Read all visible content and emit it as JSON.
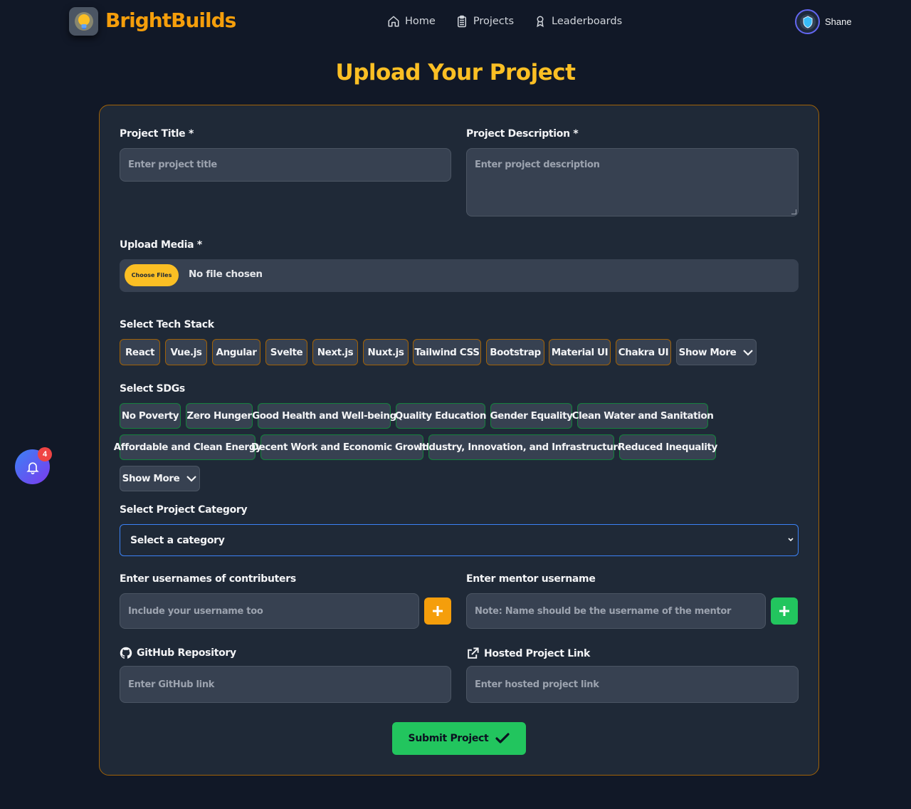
{
  "nav": {
    "brand": "BrightBuilds",
    "links": [
      {
        "label": "Home",
        "icon": "home-icon"
      },
      {
        "label": "Projects",
        "icon": "clipboard-icon"
      },
      {
        "label": "Leaderboards",
        "icon": "award-icon"
      }
    ],
    "user_name": "Shane"
  },
  "page_title": "Upload Your Project",
  "form": {
    "title_label": "Project Title *",
    "title_placeholder": "Enter project title",
    "description_label": "Project Description *",
    "description_placeholder": "Enter project description",
    "media_label": "Upload Media *",
    "choose_files": "Choose Files",
    "no_file": "No file chosen",
    "tech_label": "Select Tech Stack",
    "tech_stack": [
      "React",
      "Vue.js",
      "Angular",
      "Svelte",
      "Next.js",
      "Nuxt.js",
      "Tailwind CSS",
      "Bootstrap",
      "Material UI",
      "Chakra UI"
    ],
    "tech_show_more": "Show More",
    "sdg_label": "Select SDGs",
    "sdgs": [
      "No Poverty",
      "Zero Hunger",
      "Good Health and Well-being",
      "Quality Education",
      "Gender Equality",
      "Clean Water and Sanitation",
      "Affordable and Clean Energy",
      "Decent Work and Economic Growth",
      "Industry, Innovation, and Infrastructure",
      "Reduced Inequality"
    ],
    "sdg_show_more": "Show More",
    "category_label": "Select Project Category",
    "category_selected": "Select a category",
    "contributors_label": "Enter usernames of contributers",
    "contributors_placeholder": "Include your username too",
    "mentor_label": "Enter mentor username",
    "mentor_placeholder": "Note: Name should be the username of the mentor",
    "github_label": "GitHub Repository",
    "github_placeholder": "Enter GitHub link",
    "hosted_label": "Hosted Project Link",
    "hosted_placeholder": "Enter hosted project link",
    "submit_label": "Submit Project"
  },
  "notifications": {
    "count": "4"
  },
  "colors": {
    "background": "#111827",
    "card": "#1f2937",
    "accent": "#fbbf24",
    "brand": "#f59e0b",
    "green": "#22c55e",
    "add_contributor": "#f59e0b",
    "add_mentor": "#22c55e"
  }
}
